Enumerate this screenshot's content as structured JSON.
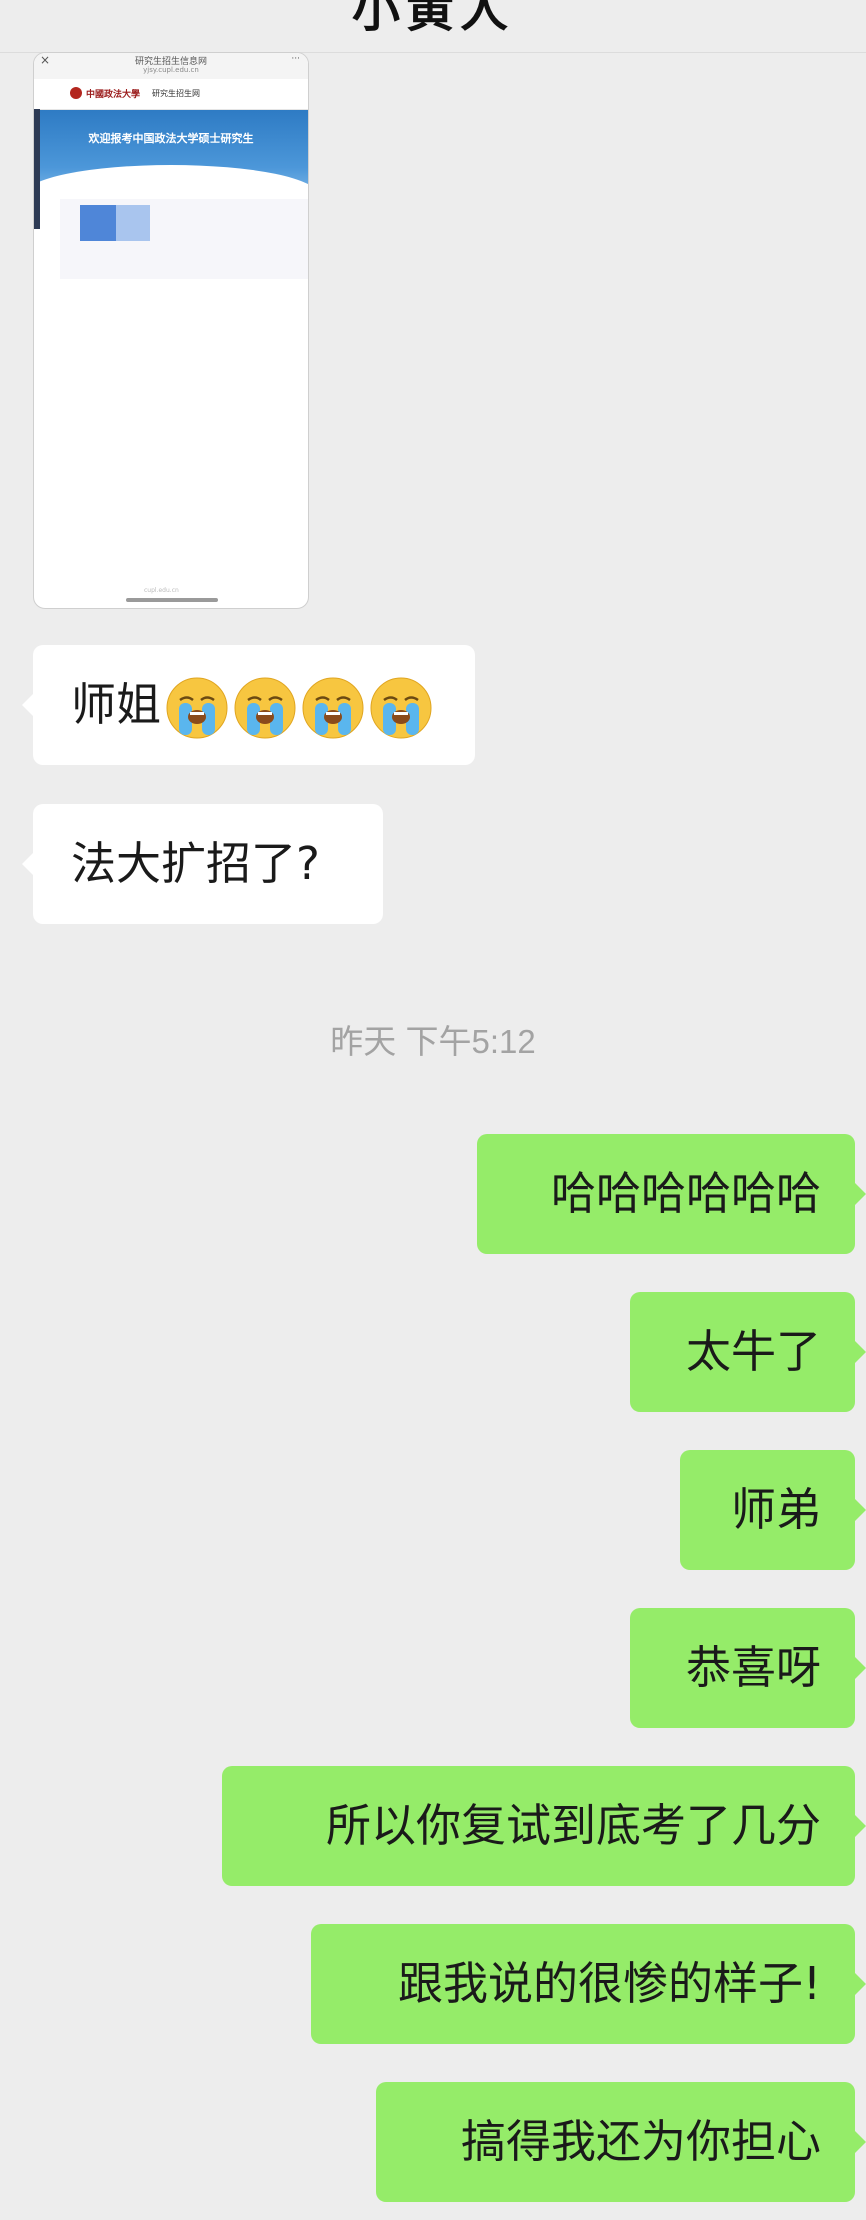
{
  "header": {
    "title": "小黄人"
  },
  "shared_screenshot": {
    "close_glyph": "×",
    "status_title": "研究生招生信息网",
    "status_url": "yjsy.cupl.edu.cn",
    "more_glyph": "···",
    "university_logo_text": "中國政法大學",
    "site_section": "研究生招生网",
    "banner_text": "欢迎报考中国政法大学硕士研究生",
    "home_indicator_text": "cupl.edu.cn"
  },
  "messages": [
    {
      "side": "incoming",
      "text": "师姐",
      "emoji": [
        "loudly-crying-face-icon",
        "loudly-crying-face-icon",
        "loudly-crying-face-icon",
        "loudly-crying-face-icon"
      ]
    },
    {
      "side": "incoming",
      "text": "法大扩招了?"
    },
    {
      "side": "outgoing",
      "text": "哈哈哈哈哈哈"
    },
    {
      "side": "outgoing",
      "text": "太牛了"
    },
    {
      "side": "outgoing",
      "text": "师弟"
    },
    {
      "side": "outgoing",
      "text": "恭喜呀"
    },
    {
      "side": "outgoing",
      "text": "所以你复试到底考了几分"
    },
    {
      "side": "outgoing",
      "text": "跟我说的很惨的样子!"
    },
    {
      "side": "outgoing",
      "text": "搞得我还为你担心"
    }
  ],
  "timestamp": "昨天 下午5:12",
  "colors": {
    "background": "#ededed",
    "incoming_bubble": "#ffffff",
    "outgoing_bubble": "#95ec69",
    "timestamp_text": "#a3a3a3"
  }
}
